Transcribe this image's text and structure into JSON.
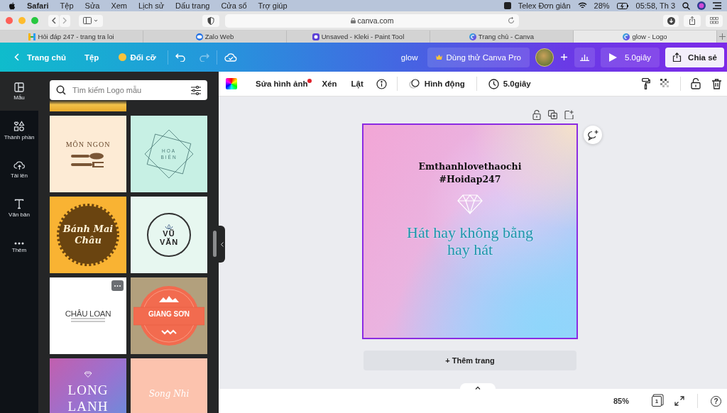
{
  "menubar": {
    "app": "Safari",
    "items": [
      "Tệp",
      "Sửa",
      "Xem",
      "Lịch sử",
      "Dấu trang",
      "Cửa sổ",
      "Trợ giúp"
    ],
    "input_method": "Telex Đơn giản",
    "battery": "28%",
    "clock": "05:58, Th 3"
  },
  "browser": {
    "address": "canva.com",
    "tabs": [
      {
        "kind": "hoidap",
        "title": "Hỏi đáp 247 - trang tra loi",
        "selected": false
      },
      {
        "kind": "zalo",
        "title": "Zalo Web",
        "selected": false
      },
      {
        "kind": "kleki",
        "title": "Unsaved - Kleki - Paint Tool",
        "selected": false
      },
      {
        "kind": "canva",
        "title": "Trang chủ - Canva",
        "selected": false
      },
      {
        "kind": "canva",
        "title": "glow - Logo",
        "selected": true
      }
    ]
  },
  "header": {
    "home": "Trang chủ",
    "file": "Tệp",
    "resize": "Đổi cỡ",
    "title": "glow",
    "pro": "Dùng thử Canva Pro",
    "play": "5.0giây",
    "share": "Chia sẻ"
  },
  "rail": [
    {
      "kind": "templates",
      "label": "Mẫu",
      "selected": true
    },
    {
      "kind": "elements",
      "label": "Thành phần",
      "selected": false
    },
    {
      "kind": "uploads",
      "label": "Tải lên",
      "selected": false
    },
    {
      "kind": "text",
      "label": "Văn bản",
      "selected": false
    },
    {
      "kind": "more",
      "label": "Thêm",
      "selected": false
    }
  ],
  "search": {
    "placeholder": "Tìm kiếm Logo mẫu"
  },
  "templates": [
    {
      "kind": "mon-ngon",
      "title": "MÔN NGON"
    },
    {
      "kind": "hoa-bien",
      "title": "HOA BIỂN"
    },
    {
      "kind": "banh-mai-chau",
      "title": "Bánh Mai Châu"
    },
    {
      "kind": "vu-van",
      "title": "VŨ VĂN"
    },
    {
      "kind": "chau-loan",
      "title": "CHÂU LOAN"
    },
    {
      "kind": "giang-son",
      "title": "GIANG SƠN"
    },
    {
      "kind": "long-lanh",
      "title": "LONG LANH"
    },
    {
      "kind": "song-nhi",
      "title": "Song Nhi"
    }
  ],
  "toolbar": {
    "edit": "Sửa hình ảnh",
    "crop": "Xén",
    "flip": "Lật",
    "animate": "Hình động",
    "duration": "5.0giây"
  },
  "design": {
    "title": "Emthanhlovethaochi",
    "tag": "#Hoidap247",
    "slogan": "Hát hay không bằng hay hát"
  },
  "add_page": "+ Thêm trang",
  "footer": {
    "zoom": "85%",
    "page_count": "1",
    "help": "?"
  }
}
